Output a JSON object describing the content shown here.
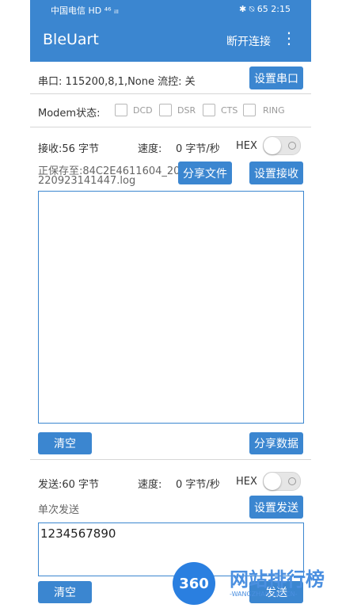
{
  "statusbar": {
    "left": "中国电信 HD ⁴⁶ ᵢₗₗ",
    "right": "✱ ⍉ 65 2:15"
  },
  "appbar": {
    "title": "BleUart",
    "disconnect": "断开连接"
  },
  "serial": {
    "info": "串口:  115200,8,1,None 流控: 关",
    "button": "设置串口"
  },
  "modem": {
    "label": "Modem状态:",
    "items": [
      "DCD",
      "DSR",
      "CTS",
      "RING"
    ]
  },
  "receive": {
    "count": "接收:56 字节",
    "speed_label": "速度:",
    "speed_value": "0 字节/秒",
    "hex_label": "HEX",
    "save_line1": "正保存至:84C2E4611604_20",
    "save_line2": "220923141447.log",
    "share_file": "分享文件",
    "settings": "设置接收",
    "clear": "清空",
    "share_data": "分享数据",
    "content": ""
  },
  "send": {
    "count": "发送:60 字节",
    "speed_label": "速度:",
    "speed_value": "0 字节/秒",
    "hex_label": "HEX",
    "mode_label": "单次发送",
    "settings": "设置发送",
    "input_value": "1234567890",
    "clear": "清空",
    "send": "发送"
  },
  "watermark": {
    "logo": "360",
    "text": "网站排行榜",
    "url": "-WANGZHAN 360.CN-"
  }
}
